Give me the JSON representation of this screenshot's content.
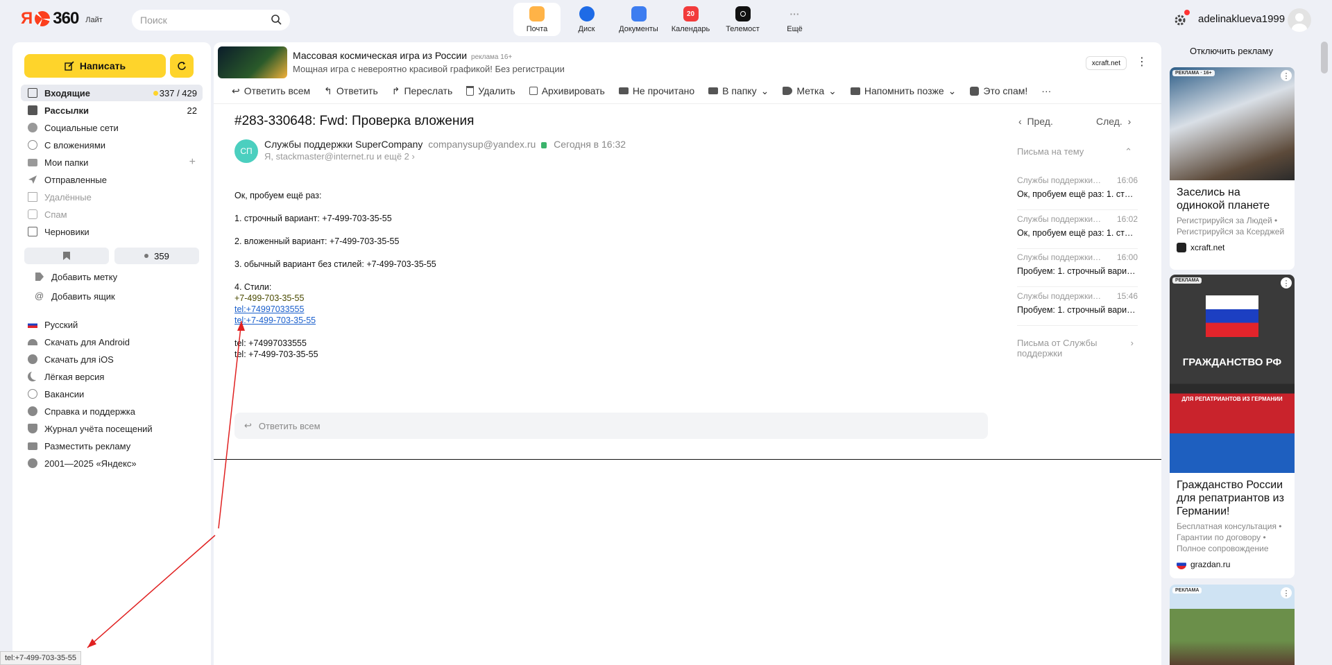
{
  "header": {
    "logo_ya": "Я",
    "logo_num": "360",
    "logo_lite": "Лайт",
    "search_placeholder": "Поиск",
    "apps": [
      {
        "label": "Почта",
        "color": "#ff9b2e",
        "badge": ""
      },
      {
        "label": "Диск",
        "color": "#1e6be6",
        "badge": ""
      },
      {
        "label": "Документы",
        "color": "#3d7df0",
        "badge": ""
      },
      {
        "label": "Календарь",
        "color": "#f23b3b",
        "badge": "20"
      },
      {
        "label": "Телемост",
        "color": "#111111",
        "badge": ""
      },
      {
        "label": "Ещё",
        "color": "#ffffff",
        "badge": "···"
      }
    ],
    "username": "adelinaklueva1999"
  },
  "sidebar": {
    "compose_label": "Написать",
    "folders": [
      {
        "label": "Входящие",
        "count": "337 / 429",
        "icon": "inbox-icon"
      },
      {
        "label": "Рассылки",
        "count": "22",
        "icon": "newsletter-icon"
      },
      {
        "label": "Социальные сети",
        "count": "",
        "icon": "social-icon"
      },
      {
        "label": "С вложениями",
        "count": "",
        "icon": "attachment-icon"
      },
      {
        "label": "Мои папки",
        "count": "",
        "icon": "folder-icon"
      },
      {
        "label": "Отправленные",
        "count": "",
        "icon": "send-icon"
      },
      {
        "label": "Удалённые",
        "count": "",
        "icon": "trash-icon"
      },
      {
        "label": "Спам",
        "count": "",
        "icon": "spam-icon"
      },
      {
        "label": "Черновики",
        "count": "",
        "icon": "draft-icon"
      }
    ],
    "filter_unread_count": "359",
    "add_label": "Добавить метку",
    "add_mailbox": "Добавить ящик",
    "links": [
      {
        "label": "Русский",
        "icon": "flag-icon"
      },
      {
        "label": "Скачать для Android",
        "icon": "android-icon"
      },
      {
        "label": "Скачать для iOS",
        "icon": "apple-icon"
      },
      {
        "label": "Лёгкая версия",
        "icon": "moon-icon"
      },
      {
        "label": "Вакансии",
        "icon": "vacancy-icon"
      },
      {
        "label": "Справка и поддержка",
        "icon": "help-icon"
      },
      {
        "label": "Журнал учёта посещений",
        "icon": "shield-icon"
      },
      {
        "label": "Разместить рекламу",
        "icon": "bag-icon"
      },
      {
        "label": "2001—2025 «Яндекс»",
        "icon": "copyright-icon"
      }
    ]
  },
  "banner": {
    "title": "Массовая космическая игра из России",
    "label": "реклама 16+",
    "desc": "Мощная игра с невероятно красивой графикой! Без регистрации",
    "domain": "xcraft.net"
  },
  "toolbar": [
    {
      "label": "Ответить всем",
      "icon": "reply-all-icon"
    },
    {
      "label": "Ответить",
      "icon": "reply-icon"
    },
    {
      "label": "Переслать",
      "icon": "forward-icon"
    },
    {
      "label": "Удалить",
      "icon": "trash-icon"
    },
    {
      "label": "Архивировать",
      "icon": "archive-icon"
    },
    {
      "label": "Не прочитано",
      "icon": "mail-icon"
    },
    {
      "label": "В папку",
      "icon": "folder-icon"
    },
    {
      "label": "Метка",
      "icon": "tag-icon"
    },
    {
      "label": "Напомнить позже",
      "icon": "reminder-icon"
    },
    {
      "label": "Это спам!",
      "icon": "spam-icon"
    },
    {
      "label": "···",
      "icon": "more-icon"
    }
  ],
  "message": {
    "subject": "#283-330648: Fwd: Проверка вложения",
    "avatar_initials": "СП",
    "sender_name": "Службы поддержки SuperCompany",
    "sender_email": "companysup@yandex.ru",
    "date": "Сегодня в 16:32",
    "recipients": "Я, stackmaster@internet.ru и ещё 2",
    "lines": {
      "l1": "Ок, пробуем ещё раз:",
      "l2": "1. строчный вариант: +7-499-703-35-55",
      "l3": "2. вложенный вариант: +7-499-703-35-55",
      "l4": "3. обычный вариант без стилей: +7-499-703-35-55",
      "l5": "4. Стили:",
      "l6": "+7-499-703-35-55",
      "l7": "tel:+74997033555",
      "l8": "tel:+7-499-703-35-55",
      "l9": "tel: +74997033555",
      "l10": "tel: +7-499-703-35-55"
    },
    "reply_all": "Ответить всем"
  },
  "thread": {
    "prev": "Пред.",
    "next": "След.",
    "header": "Письма на тему",
    "items": [
      {
        "from": "Службы поддержки SuperCompany",
        "time": "16:06",
        "snippet": "Ок, пробуем ещё раз: 1. строчный вариант"
      },
      {
        "from": "Службы поддержки SuperCompany",
        "time": "16:02",
        "snippet": "Ок, пробуем ещё раз: 1. строчный вариант"
      },
      {
        "from": "Службы поддержки SuperCompany",
        "time": "16:00",
        "snippet": "Пробуем: 1. строчный вариант"
      },
      {
        "from": "Службы поддержки SuperCompany",
        "time": "15:46",
        "snippet": "Пробуем: 1. строчный вариант"
      }
    ],
    "more": "Письма от Службы поддержки"
  },
  "ads": {
    "disable": "Отключить рекламу",
    "cards": [
      {
        "badge": "РЕКЛАМА · 16+",
        "title": "Заселись на одинокой планете",
        "desc": "Регистрируйся за Людей • Регистрируйся за Ксерджей",
        "domain": "xcraft.net"
      },
      {
        "badge": "РЕКЛАМА",
        "img_text": "ГРАЖДАНСТВО РФ",
        "img_sub": "ДЛЯ РЕПАТРИАНТОВ ИЗ ГЕРМАНИИ",
        "title": "Гражданство России для репатриантов из Германии!",
        "desc": "Бесплатная консультация • Гарантии по договору • Полное сопровождение",
        "domain": "grazdan.ru"
      },
      {
        "badge": "РЕКЛАМА"
      }
    ]
  },
  "status_tip": "tel:+7-499-703-35-55"
}
